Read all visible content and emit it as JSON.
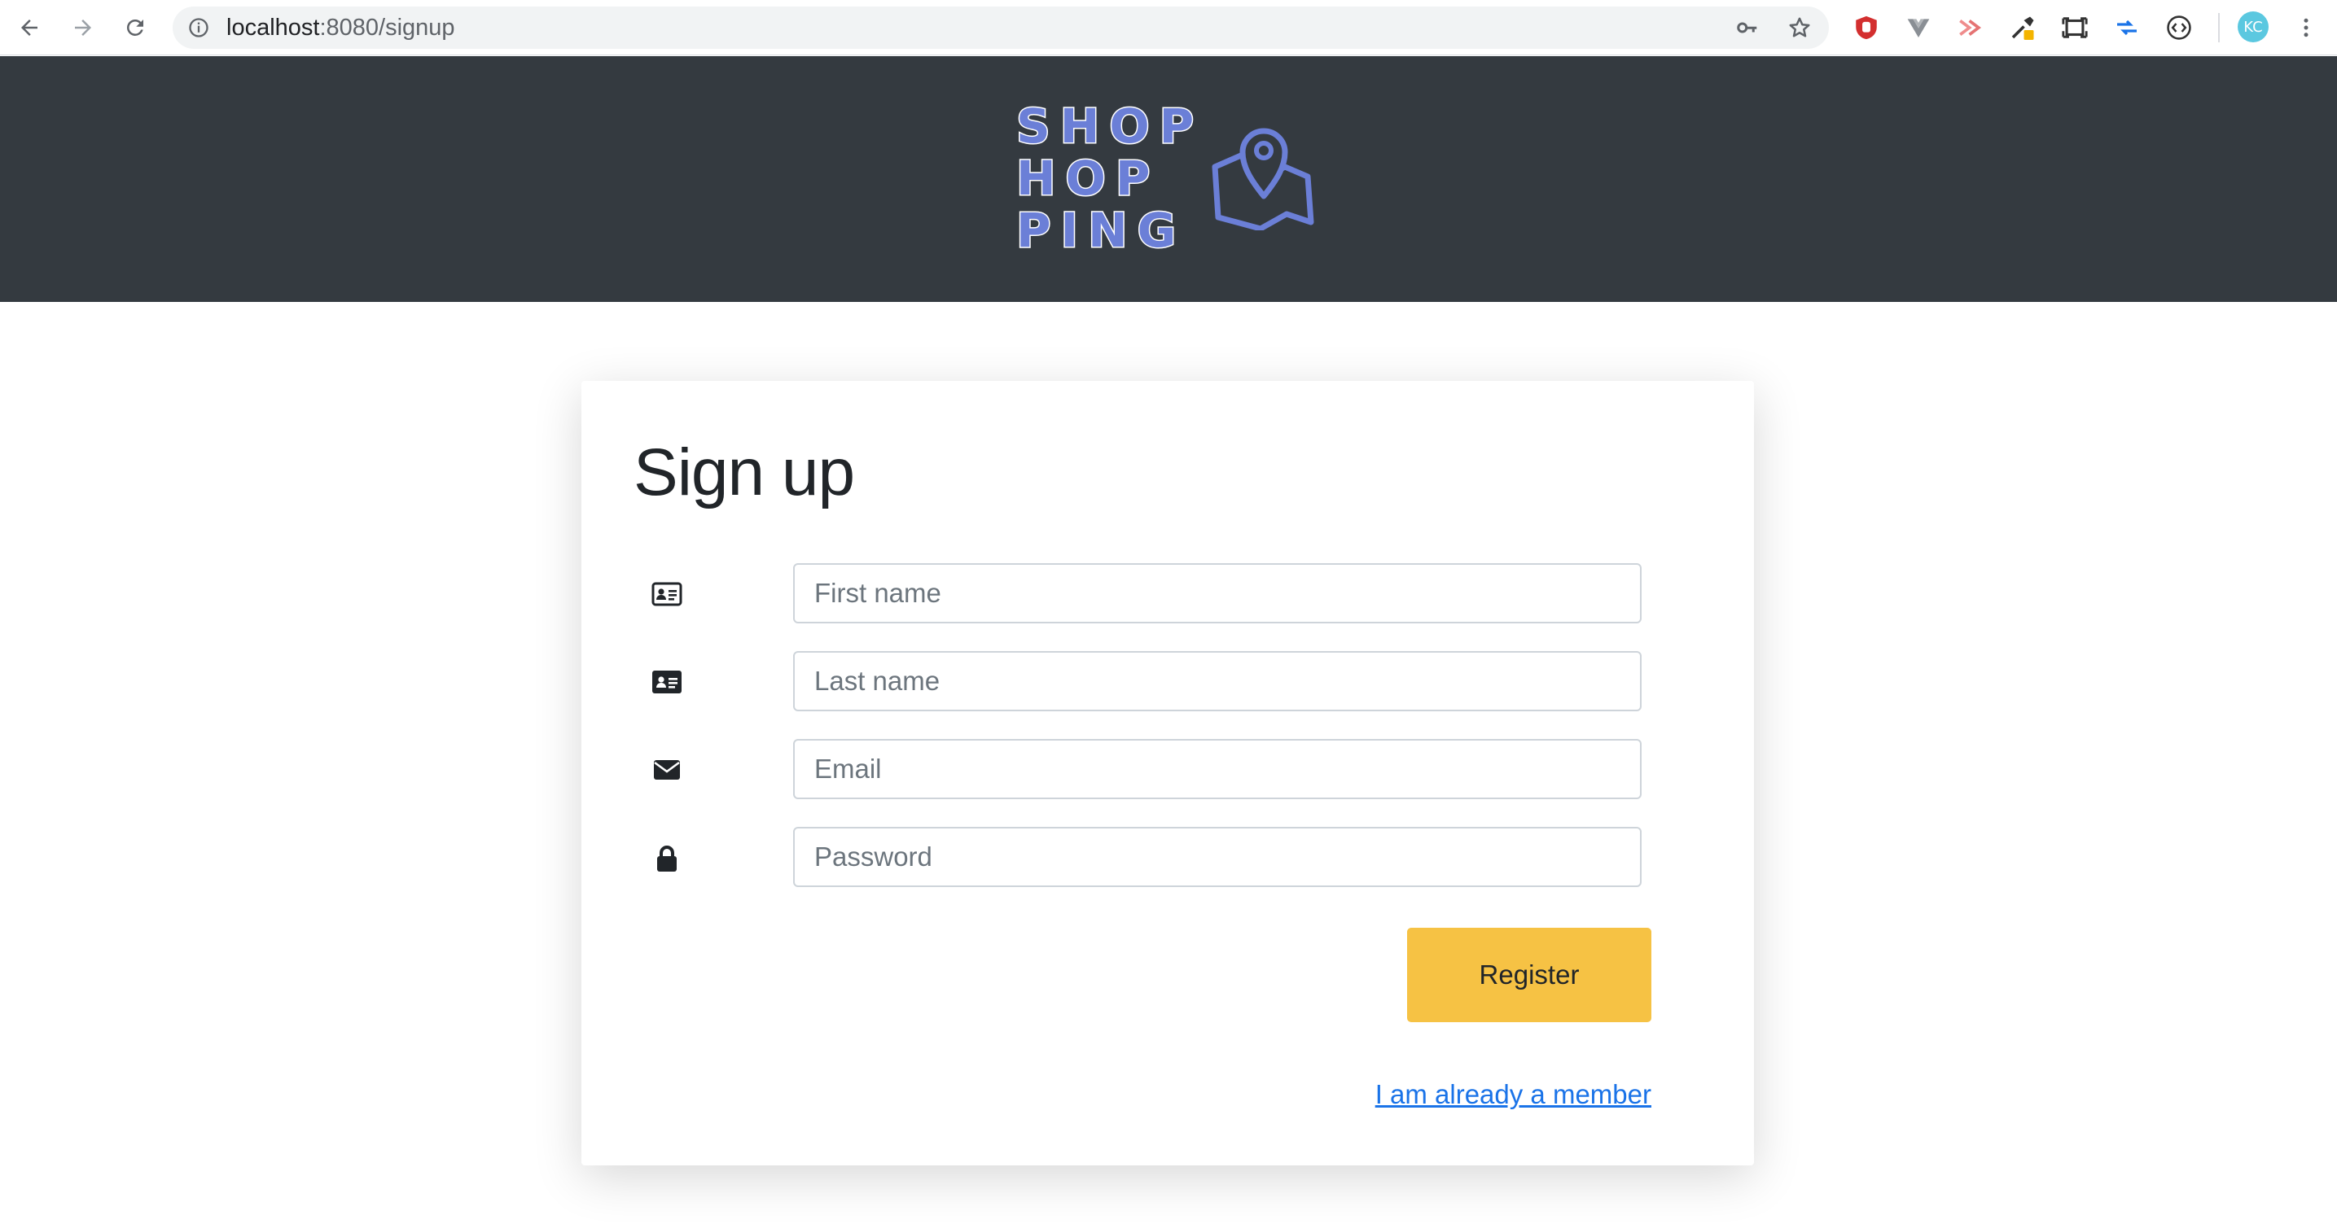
{
  "browser": {
    "url_host": "localhost",
    "url_path": ":8080/signup",
    "profile_initials": "KC",
    "icons": {
      "back": "arrow-left-icon",
      "forward": "arrow-right-icon",
      "reload": "reload-icon",
      "site_info": "info-icon",
      "password_key": "key-icon",
      "bookmark": "star-icon",
      "menu": "kebab-menu-icon"
    },
    "extensions": [
      "ublock-icon",
      "vue-devtools-icon",
      "redux-devtools-icon",
      "eyedropper-icon",
      "screenshot-icon",
      "arrows-icon",
      "code-icon"
    ]
  },
  "header": {
    "logo_lines": [
      "SHOP",
      "HOP",
      "PING"
    ],
    "logo_icon": "map-pin-icon",
    "logo_color": "#6b7fd7",
    "background": "#343a40"
  },
  "form": {
    "title": "Sign up",
    "fields": [
      {
        "icon": "id-card-outline-icon",
        "placeholder": "First name",
        "value": ""
      },
      {
        "icon": "id-card-filled-icon",
        "placeholder": "Last name",
        "value": ""
      },
      {
        "icon": "envelope-icon",
        "placeholder": "Email",
        "value": ""
      },
      {
        "icon": "lock-icon",
        "placeholder": "Password",
        "value": ""
      }
    ],
    "register_label": "Register",
    "register_color": "#f6c244",
    "member_link": "I am already a member"
  }
}
